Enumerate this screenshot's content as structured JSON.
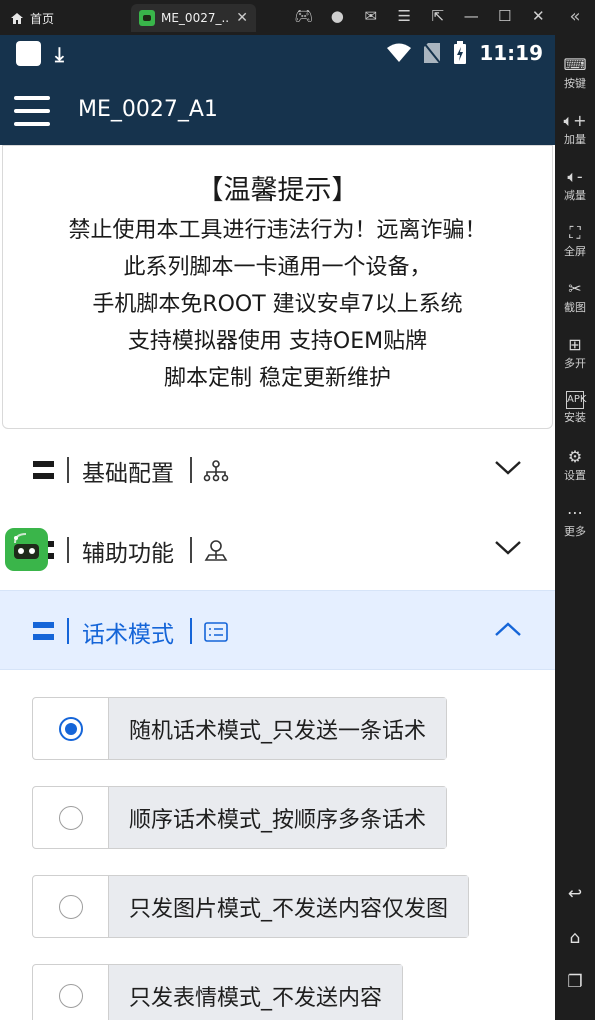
{
  "emulator": {
    "home_tab": "首页",
    "app_tab": "ME_0027_...",
    "close_tab_icon": "close-icon",
    "top_icons": [
      "gamepad-icon",
      "user-icon",
      "mail-icon",
      "menu-icon",
      "popout-icon",
      "minimize-icon",
      "maximize-icon",
      "close-icon"
    ],
    "side_buttons": [
      {
        "icon": "keyboard-icon",
        "label": "按键"
      },
      {
        "icon": "volume-up-icon",
        "label": "加量"
      },
      {
        "icon": "volume-down-icon",
        "label": "减量"
      },
      {
        "icon": "fullscreen-icon",
        "label": "全屏"
      },
      {
        "icon": "scissors-icon",
        "label": "截图"
      },
      {
        "icon": "multi-open-icon",
        "label": "多开"
      },
      {
        "icon": "apk-icon",
        "label": "安装"
      },
      {
        "icon": "gear-icon",
        "label": "设置"
      },
      {
        "icon": "more-icon",
        "label": "更多"
      }
    ],
    "nav_icons": [
      "back-icon",
      "home-icon",
      "recents-icon"
    ]
  },
  "status_bar": {
    "time": "11:19"
  },
  "app_bar": {
    "title": "ME_0027_A1"
  },
  "notice": {
    "title": "【温馨提示】",
    "lines": [
      "禁止使用本工具进行违法行为！远离诈骗！",
      "此系列脚本一卡通用一个设备，",
      "手机脚本免ROOT 建议安卓7以上系统",
      "支持模拟器使用 支持OEM贴牌",
      "脚本定制 稳定更新维护"
    ]
  },
  "sections": [
    {
      "label": "基础配置",
      "icon": "sitemap-icon",
      "expanded": false
    },
    {
      "label": "辅助功能",
      "icon": "person-pin-icon",
      "expanded": false
    },
    {
      "label": "话术模式",
      "icon": "list-card-icon",
      "expanded": true
    }
  ],
  "mode_options": [
    {
      "label": "随机话术模式_只发送一条话术",
      "selected": true
    },
    {
      "label": "顺序话术模式_按顺序多条话术",
      "selected": false
    },
    {
      "label": "只发图片模式_不发送内容仅发图",
      "selected": false
    },
    {
      "label": "只发表情模式_不发送内容",
      "selected": false
    }
  ],
  "colors": {
    "app_bar": "#16334d",
    "accent": "#1565d8",
    "active_section_bg": "#e5efff"
  }
}
